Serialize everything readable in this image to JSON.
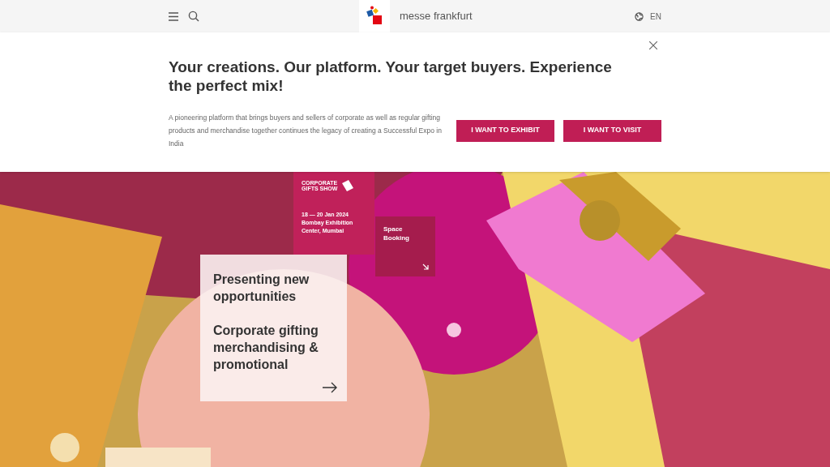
{
  "header": {
    "brand": "messe frankfurt",
    "language": "EN"
  },
  "banner": {
    "title": "Your creations. Our platform. Your target buyers. Experience the perfect mix!",
    "text": "A pioneering platform that brings buyers and sellers of corporate as well as regular gifting products and merchandise together continues the legacy of creating a Successful Expo in India",
    "buttons": [
      "I WANT TO EXHIBIT",
      "I WANT TO VISIT"
    ]
  },
  "hero": {
    "event_logo": [
      "CORPORATE",
      "GIFTS SHOW"
    ],
    "event_details": [
      "18 — 20 Jan 2024",
      "Bombay Exhibition Center, Mumbai"
    ],
    "booking_link": "Space Booking",
    "teaser": [
      "Presenting new opportunities",
      "Corporate gifting merchandising & promotional"
    ]
  }
}
